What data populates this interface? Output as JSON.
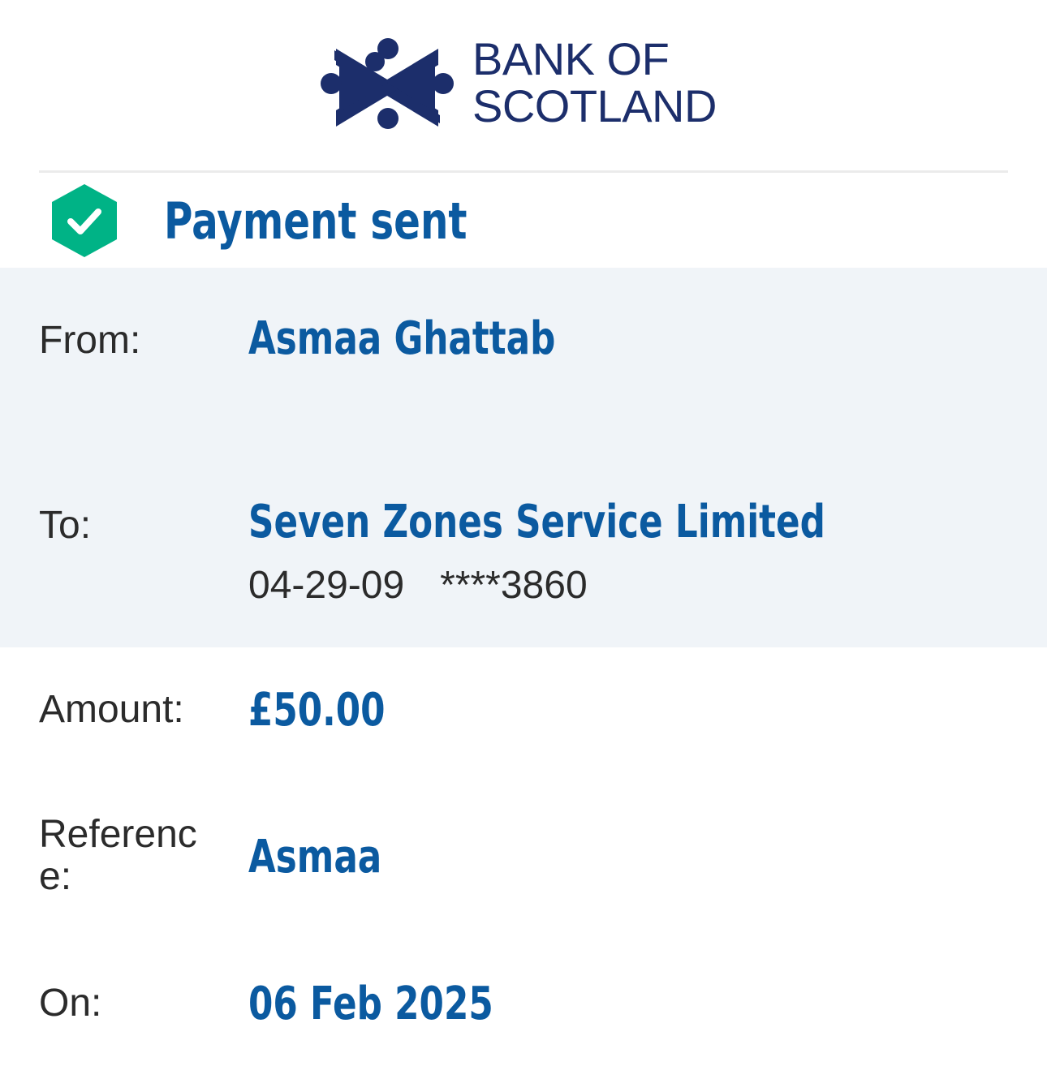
{
  "brand": {
    "name_line1": "BANK OF",
    "name_line2": "SCOTLAND",
    "color": "#1c2e6b"
  },
  "status": {
    "title": "Payment sent",
    "icon": "check-hexagon-icon",
    "icon_color": "#00b386",
    "title_color": "#0b5aa0"
  },
  "details": {
    "from_label": "From:",
    "from_value": "Asmaa Ghattab",
    "to_label": "To:",
    "to_value": "Seven Zones Service Limited",
    "to_sort_code": "04-29-09",
    "to_account": "****3860",
    "amount_label": "Amount:",
    "amount_value": "£50.00",
    "reference_label": "Reference:",
    "reference_value": "Asmaa",
    "on_label": "On:",
    "on_value": "06 Feb 2025"
  },
  "colors": {
    "band_background": "#f0f4f8",
    "label_text": "#2b2b2b",
    "value_text": "#0b5aa0"
  }
}
